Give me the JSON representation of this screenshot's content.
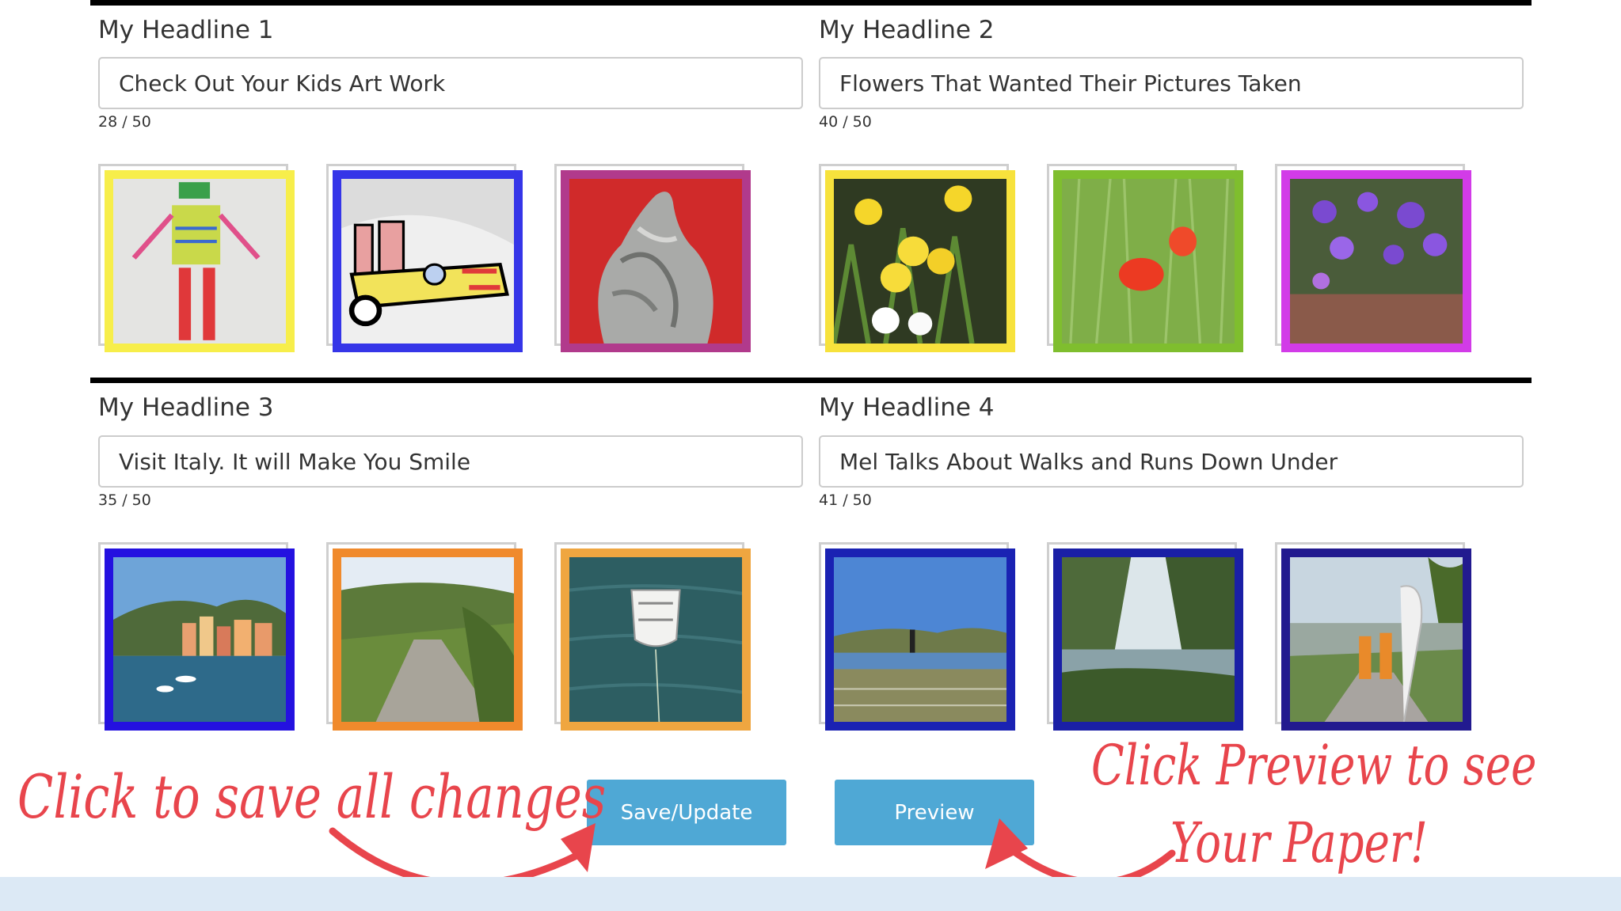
{
  "sections": [
    {
      "headline_label": "My Headline 1",
      "headline_value": "Check Out Your Kids Art Work",
      "counter": "28 / 50",
      "frame_colors": [
        "#f7ee4a",
        "#3535e8",
        "#b13a8c"
      ],
      "images": [
        "kids-drawing-robot",
        "kids-drawing-airplane",
        "clay-hands-sculpture"
      ]
    },
    {
      "headline_label": "My Headline 2",
      "headline_value": "Flowers That Wanted Their Pictures Taken",
      "counter": "40 / 50",
      "frame_colors": [
        "#f7e23c",
        "#7fbe2e",
        "#d23be8"
      ],
      "images": [
        "yellow-daffodils",
        "red-poppies",
        "purple-flowers"
      ]
    },
    {
      "headline_label": "My Headline 3",
      "headline_value": "Visit Italy. It will Make You Smile",
      "counter": "35 / 50",
      "frame_colors": [
        "#2411e0",
        "#f08a2c",
        "#efa640"
      ],
      "images": [
        "italian-harbour-town",
        "country-road",
        "white-rowboat"
      ]
    },
    {
      "headline_label": "My Headline 4",
      "headline_value": "Mel Talks About Walks and Runs Down Under",
      "counter": "41 / 50",
      "frame_colors": [
        "#1a22b3",
        "#1a1fa6",
        "#221a8f"
      ],
      "images": [
        "hiker-by-lake",
        "river-and-trees",
        "runners-at-parkrun"
      ]
    }
  ],
  "buttons": {
    "save_label": "Save/Update",
    "preview_label": "Preview"
  },
  "annotations": {
    "save_note": "Click to save all changes",
    "preview_note_line1": "Click Preview to see",
    "preview_note_line2": "Your Paper!",
    "color": "#e8454c"
  }
}
